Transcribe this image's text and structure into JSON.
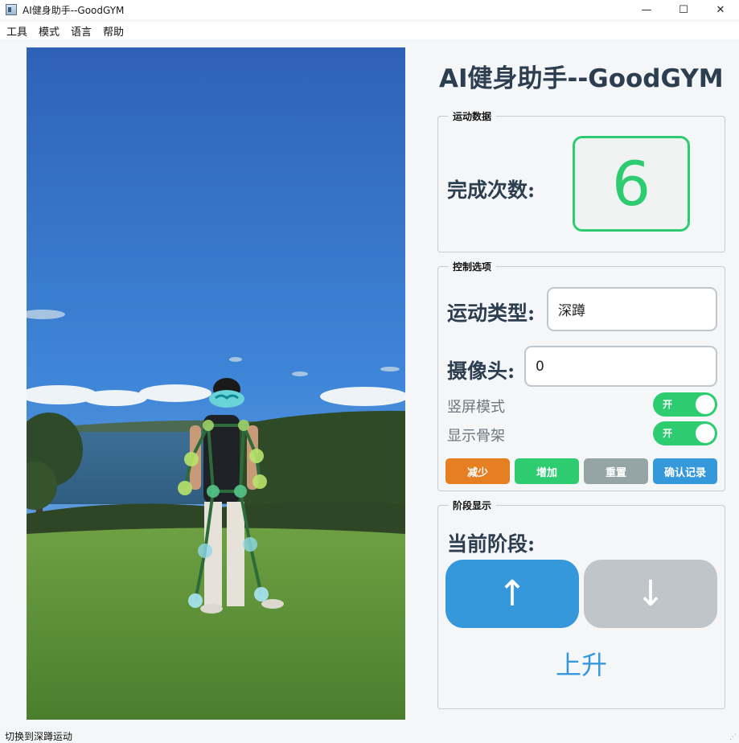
{
  "window": {
    "title": "AI健身助手--GoodGYM",
    "minimize_glyph": "—",
    "maximize_glyph": "☐",
    "close_glyph": "✕"
  },
  "menu": [
    "工具",
    "模式",
    "语言",
    "帮助"
  ],
  "header": {
    "title": "AI健身助手--GoodGYM"
  },
  "stats": {
    "group_title": "运动数据",
    "count_label": "完成次数:",
    "count_value": "6",
    "accent_color": "#2ecc71"
  },
  "controls": {
    "group_title": "控制选项",
    "exercise_label": "运动类型:",
    "exercise_value": "深蹲",
    "camera_label": "摄像头:",
    "camera_value": "0",
    "portrait_label": "竖屏模式",
    "portrait_toggle": "开",
    "skeleton_label": "显示骨架",
    "skeleton_toggle": "开",
    "buttons": {
      "decrease": "减少",
      "increase": "增加",
      "reset": "重置",
      "confirm": "确认记录"
    }
  },
  "stage": {
    "group_title": "阶段显示",
    "current_label": "当前阶段:",
    "up_glyph": "↑",
    "down_glyph": "↓",
    "stage_text": "上升"
  },
  "statusbar": {
    "message": "切换到深蹲运动"
  },
  "colors": {
    "green": "#2ecc71",
    "blue": "#3498db",
    "orange": "#e67e22",
    "gray": "#95a5a6",
    "inactive": "#c0c5ca",
    "heading": "#2c3e50"
  }
}
